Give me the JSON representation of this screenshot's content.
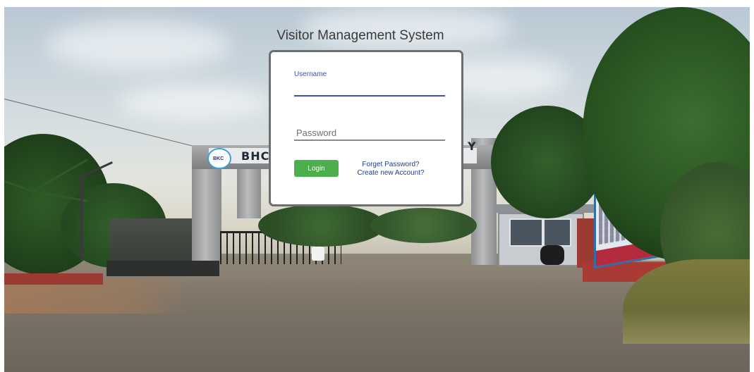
{
  "app": {
    "title": "Visitor Management System"
  },
  "login_form": {
    "username_label": "Username",
    "username_value": "",
    "password_placeholder": "Password",
    "password_value": "",
    "login_button": "Login",
    "forgot_password_link": "Forget Password?",
    "create_account_link": "Create new Account?"
  },
  "background": {
    "gate_sign_text_left": "BHC",
    "gate_sign_text_right": "Y",
    "gate_logo_text": "BKC"
  },
  "colors": {
    "accent_blue": "#3f51b5",
    "login_green": "#4cae4c",
    "link_blue": "#1a3f8f",
    "card_border": "#6e6e6e"
  }
}
